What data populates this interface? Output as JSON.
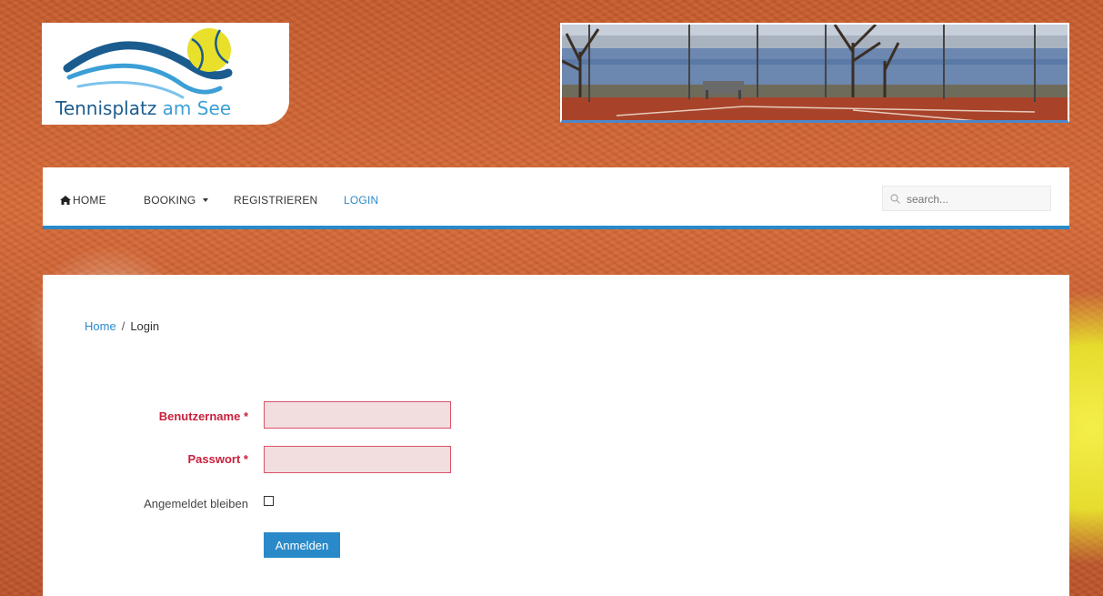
{
  "brand": {
    "name_part1": "Tennisplatz",
    "name_part2": "am See",
    "colors": {
      "primary": "#1b5c8f",
      "accent": "#2a8ac9",
      "ball": "#e8e02a",
      "error": "#c8213c"
    }
  },
  "nav": {
    "home_icon": "home-icon",
    "items": [
      {
        "label": "HOME"
      },
      {
        "label": "BOOKING",
        "dropdown": true
      },
      {
        "label": "REGISTRIEREN"
      },
      {
        "label": "LOGIN",
        "active": true
      }
    ],
    "search": {
      "placeholder": "search...",
      "icon": "search-icon"
    }
  },
  "breadcrumb": {
    "home": "Home",
    "separator": "/",
    "current": "Login"
  },
  "login_form": {
    "username_label": "Benutzername *",
    "username_value": "",
    "password_label": "Passwort *",
    "password_value": "",
    "remember_label": "Angemeldet bleiben",
    "remember_checked": false,
    "submit_label": "Anmelden"
  }
}
